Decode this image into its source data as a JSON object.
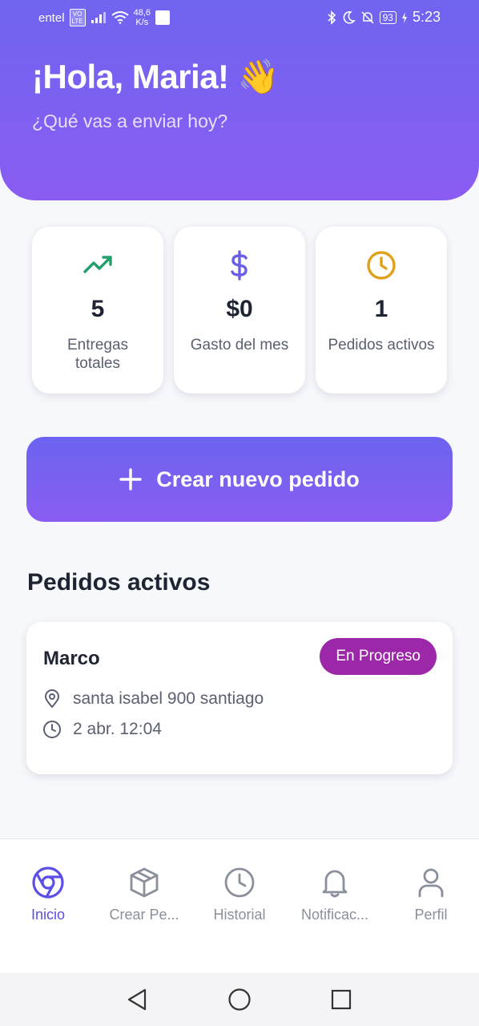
{
  "status_bar": {
    "carrier": "entel",
    "volte_top": "VO",
    "volte_bottom": "LTE",
    "speed_value": "48,6",
    "speed_unit": "K/s",
    "battery": "93",
    "time": "5:23"
  },
  "header": {
    "greeting": "¡Hola, Maria! 👋",
    "subtitle": "¿Qué vas a enviar hoy?"
  },
  "stats": [
    {
      "icon": "trending-up-icon",
      "value": "5",
      "label": "Entregas totales",
      "color": "#22a06b"
    },
    {
      "icon": "dollar-icon",
      "value": "$0",
      "label": "Gasto del mes",
      "color": "#6b5fe8"
    },
    {
      "icon": "clock-icon",
      "value": "1",
      "label": "Pedidos activos",
      "color": "#e0a21a"
    }
  ],
  "cta": {
    "label": "Crear nuevo pedido"
  },
  "active_orders": {
    "title": "Pedidos activos",
    "items": [
      {
        "name": "Marco",
        "status": "En Progreso",
        "address": "santa isabel 900 santiago",
        "time": "2 abr. 12:04"
      }
    ]
  },
  "bottom_nav": [
    {
      "label": "Inicio",
      "icon": "chrome-icon",
      "active": true
    },
    {
      "label": "Crear Pe...",
      "icon": "package-icon",
      "active": false
    },
    {
      "label": "Historial",
      "icon": "clock-icon",
      "active": false
    },
    {
      "label": "Notificac...",
      "icon": "bell-icon",
      "active": false
    },
    {
      "label": "Perfil",
      "icon": "user-icon",
      "active": false
    }
  ],
  "colors": {
    "primary": "#6f64f0",
    "accent_purple": "#9c27a9",
    "nav_active": "#5b4fe8",
    "nav_inactive": "#8a8f9c"
  }
}
